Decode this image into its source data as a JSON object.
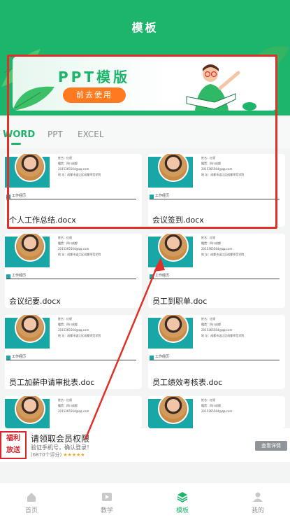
{
  "header": {
    "title": "模板"
  },
  "banner": {
    "title": "PPT模版",
    "button": "前去使用"
  },
  "tabs": [
    {
      "label": "WORD",
      "active": true
    },
    {
      "label": "PPT",
      "active": false
    },
    {
      "label": "EXCEL",
      "active": false
    }
  ],
  "resume": {
    "section": "工作经历",
    "name_label": "姓名：红规",
    "school_label": "毕业院校：成都师范学院",
    "hometown_label": "籍贯：四川成都",
    "major_label": "专 业：金融管理",
    "email_label": "2015365564@qq.com",
    "address_label": "地 址：成都市温江区成都师范学院"
  },
  "cards": [
    {
      "name": "个人工作总结.docx"
    },
    {
      "name": "会议签到.docx"
    },
    {
      "name": "会议纪要.docx"
    },
    {
      "name": "员工到职单.doc"
    },
    {
      "name": "员工加薪申请审批表.doc"
    },
    {
      "name": "员工绩效考核表.doc"
    }
  ],
  "ad": {
    "icon_text_top": "福利",
    "icon_text_bottom": "放送",
    "title": "请领取会员权限",
    "subtitle": "验证手机号，确认登录！",
    "rating_text": "(6870个评分)",
    "stars": "★★★★★",
    "button": "查看详情"
  },
  "tabbar": [
    {
      "label": "首页",
      "icon": "home-icon",
      "active": false
    },
    {
      "label": "教学",
      "icon": "play-icon",
      "active": false
    },
    {
      "label": "模板",
      "icon": "layers-icon",
      "active": true
    },
    {
      "label": "我的",
      "icon": "user-icon",
      "active": false
    }
  ],
  "colors": {
    "brand": "#1db56b",
    "accent": "#ff7a1f",
    "annotation": "#e1302a"
  }
}
